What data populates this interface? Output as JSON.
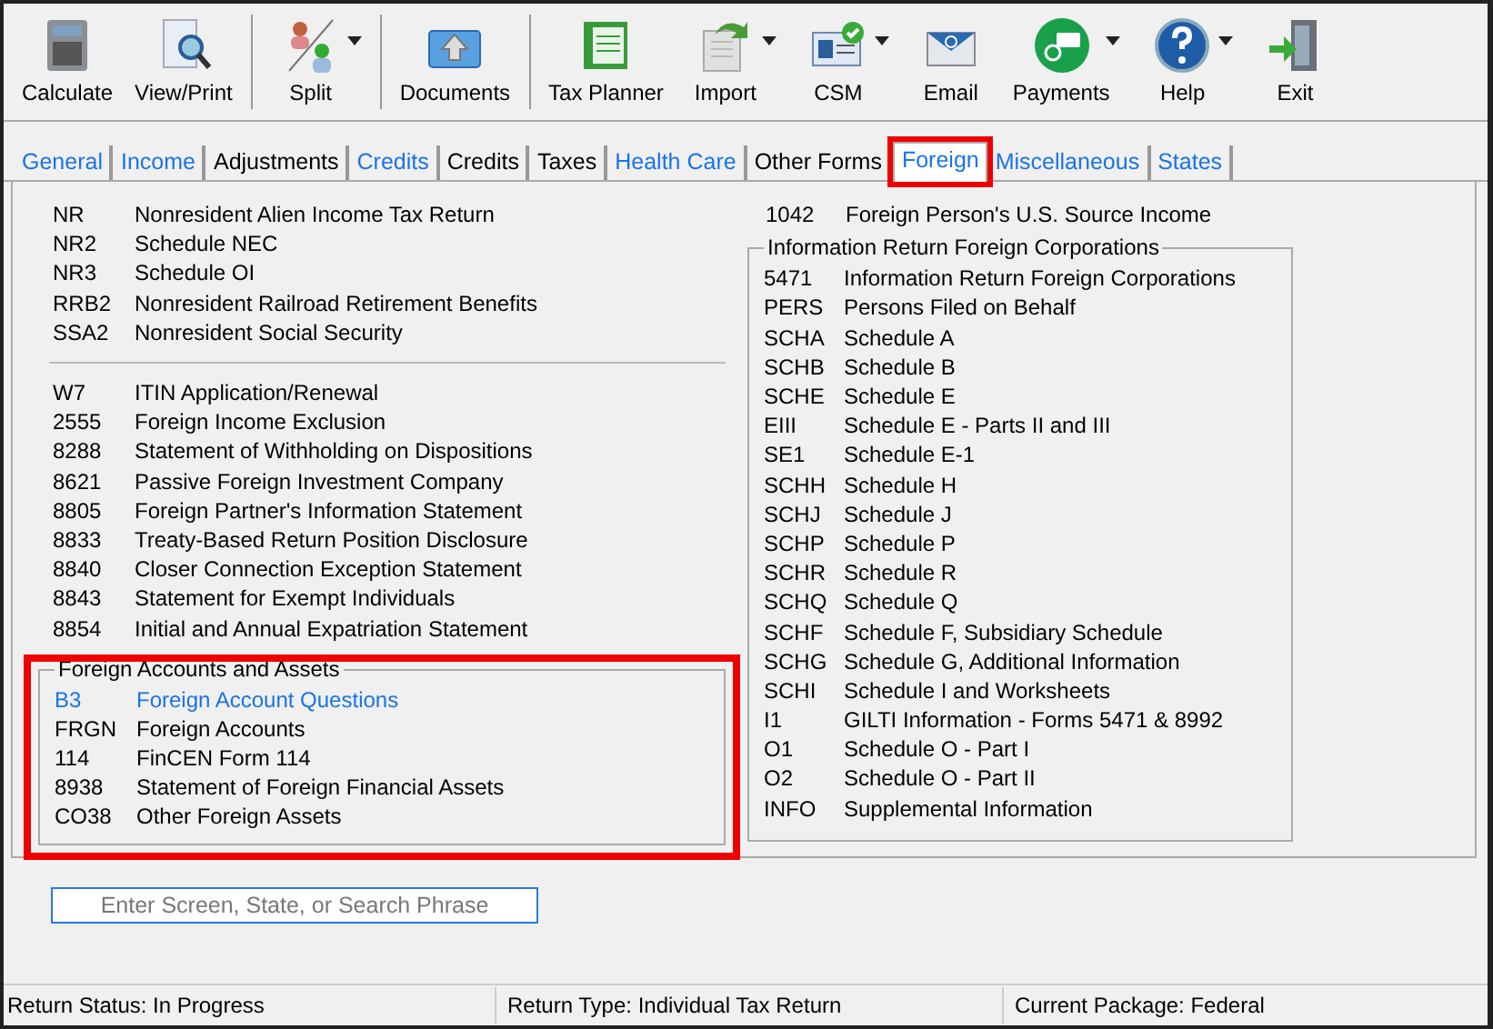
{
  "toolbar": [
    [
      {
        "label": "Calculate",
        "dropdown": false
      },
      {
        "label": "View/Print",
        "dropdown": false
      }
    ],
    [
      {
        "label": "Split",
        "dropdown": true
      }
    ],
    [
      {
        "label": "Documents",
        "dropdown": false
      }
    ],
    [
      {
        "label": "Tax Planner",
        "dropdown": false
      },
      {
        "label": "Import",
        "dropdown": true
      },
      {
        "label": "CSM",
        "dropdown": true
      },
      {
        "label": "Email",
        "dropdown": false
      },
      {
        "label": "Payments",
        "dropdown": true
      },
      {
        "label": "Help",
        "dropdown": true
      },
      {
        "label": "Exit",
        "dropdown": false
      }
    ]
  ],
  "tabs": [
    {
      "label": "General",
      "kind": "link",
      "selected": false,
      "annotated": false
    },
    {
      "label": "Income",
      "kind": "link",
      "selected": false,
      "annotated": false
    },
    {
      "label": "Adjustments",
      "kind": "plain",
      "selected": false,
      "annotated": false
    },
    {
      "label": "Credits",
      "kind": "link",
      "selected": false,
      "annotated": false
    },
    {
      "label": "Credits",
      "kind": "plain",
      "selected": false,
      "annotated": false
    },
    {
      "label": "Taxes",
      "kind": "plain",
      "selected": false,
      "annotated": false
    },
    {
      "label": "Health Care",
      "kind": "link",
      "selected": false,
      "annotated": false
    },
    {
      "label": "Other Forms",
      "kind": "plain",
      "selected": false,
      "annotated": false
    },
    {
      "label": "Foreign",
      "kind": "link",
      "selected": true,
      "annotated": true
    },
    {
      "label": "Miscellaneous",
      "kind": "link",
      "selected": false,
      "annotated": false
    },
    {
      "label": "States",
      "kind": "link",
      "selected": false,
      "annotated": false
    }
  ],
  "columns": [
    {
      "sections": [
        {
          "kind": "list",
          "items": [
            {
              "code": "NR",
              "name": "Nonresident Alien Income Tax Return",
              "kind": "plain"
            },
            {
              "code": "NR2",
              "name": "Schedule NEC",
              "kind": "plain"
            },
            {
              "code": "NR3",
              "name": "Schedule OI",
              "kind": "plain"
            },
            {
              "code": "RRB2",
              "name": "Nonresident Railroad Retirement Benefits",
              "kind": "plain"
            },
            {
              "code": "SSA2",
              "name": "Nonresident Social Security",
              "kind": "plain"
            }
          ]
        },
        {
          "kind": "divider"
        },
        {
          "kind": "list",
          "items": [
            {
              "code": "W7",
              "name": "ITIN Application/Renewal",
              "kind": "plain"
            },
            {
              "code": "2555",
              "name": "Foreign Income Exclusion",
              "kind": "plain"
            },
            {
              "code": "8288",
              "name": "Statement of Withholding on Dispositions",
              "kind": "plain"
            },
            {
              "code": "8621",
              "name": "Passive Foreign Investment Company",
              "kind": "plain"
            },
            {
              "code": "8805",
              "name": "Foreign Partner's Information Statement",
              "kind": "plain"
            },
            {
              "code": "8833",
              "name": "Treaty-Based Return Position Disclosure",
              "kind": "plain"
            },
            {
              "code": "8840",
              "name": "Closer Connection Exception Statement",
              "kind": "plain"
            },
            {
              "code": "8843",
              "name": "Statement for Exempt Individuals",
              "kind": "plain"
            },
            {
              "code": "8854",
              "name": "Initial and Annual Expatriation Statement",
              "kind": "plain"
            }
          ]
        },
        {
          "kind": "group",
          "title": "Foreign Accounts and Assets",
          "annotated": true,
          "items": [
            {
              "code": "B3",
              "name": "Foreign Account Questions",
              "kind": "link"
            },
            {
              "code": "FRGN",
              "name": "Foreign Accounts",
              "kind": "plain"
            },
            {
              "code": "114",
              "name": "FinCEN Form 114",
              "kind": "plain"
            },
            {
              "code": "8938",
              "name": "Statement of Foreign Financial Assets",
              "kind": "plain"
            },
            {
              "code": "CO38",
              "name": "Other Foreign Assets",
              "kind": "plain"
            }
          ]
        }
      ]
    },
    {
      "sections": [
        {
          "kind": "list",
          "items": [
            {
              "code": "1042",
              "name": "Foreign Person's U.S. Source Income",
              "kind": "plain"
            }
          ]
        },
        {
          "kind": "group",
          "title": "Information Return Foreign Corporations",
          "items": [
            {
              "code": "5471",
              "name": "Information Return Foreign Corporations",
              "kind": "plain"
            },
            {
              "code": "PERS",
              "name": "Persons Filed on Behalf",
              "kind": "plain"
            },
            {
              "code": "SCHA",
              "name": "Schedule A",
              "kind": "plain"
            },
            {
              "code": "SCHB",
              "name": "Schedule B",
              "kind": "plain"
            },
            {
              "code": "SCHE",
              "name": "Schedule E",
              "kind": "plain"
            },
            {
              "code": "EIII",
              "name": "Schedule E - Parts II and III",
              "kind": "plain"
            },
            {
              "code": "SE1",
              "name": "Schedule E-1",
              "kind": "plain"
            },
            {
              "code": "SCHH",
              "name": "Schedule H",
              "kind": "plain"
            },
            {
              "code": "SCHJ",
              "name": "Schedule J",
              "kind": "plain"
            },
            {
              "code": "SCHP",
              "name": "Schedule P",
              "kind": "plain"
            },
            {
              "code": "SCHR",
              "name": "Schedule R",
              "kind": "plain"
            },
            {
              "code": "SCHQ",
              "name": "Schedule Q",
              "kind": "plain"
            },
            {
              "code": "SCHF",
              "name": "Schedule F, Subsidiary Schedule",
              "kind": "plain"
            },
            {
              "code": "SCHG",
              "name": "Schedule G, Additional Information",
              "kind": "plain"
            },
            {
              "code": "SCHI",
              "name": "Schedule I and Worksheets",
              "kind": "plain"
            },
            {
              "code": "I1",
              "name": "GILTI Information - Forms 5471 & 8992",
              "kind": "plain"
            },
            {
              "code": "O1",
              "name": "Schedule O - Part I",
              "kind": "plain"
            },
            {
              "code": "O2",
              "name": "Schedule O - Part II",
              "kind": "plain"
            },
            {
              "code": "INFO",
              "name": "Supplemental Information",
              "kind": "plain"
            }
          ]
        }
      ]
    }
  ],
  "search": {
    "placeholder": "Enter Screen, State, or Search Phrase"
  },
  "status_bar": [
    "Return Status: In Progress",
    "Return Type: Individual Tax Return",
    "Current Package: Federal"
  ]
}
